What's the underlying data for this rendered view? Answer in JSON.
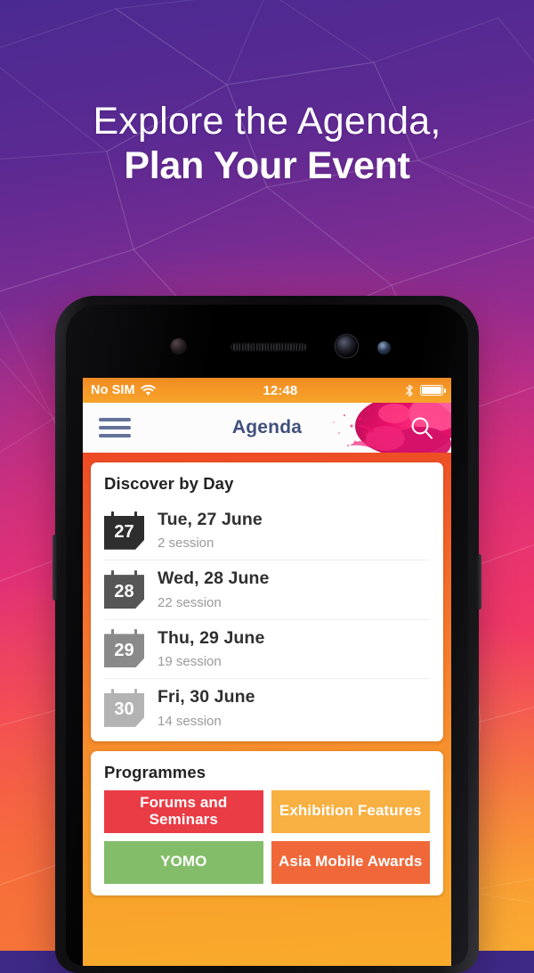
{
  "promo": {
    "headline_line1": "Explore the Agenda,",
    "headline_line2": "Plan Your Event",
    "bg_purple": "#4a2a91",
    "bg_magenta": "#ef3a62",
    "bg_orange": "#f9a12b"
  },
  "status_bar": {
    "carrier": "No SIM",
    "wifi_icon": "wifi-icon",
    "time": "12:48",
    "bluetooth_icon": "bluetooth-icon",
    "battery_icon": "battery-full-icon",
    "background": "#f59a27"
  },
  "nav_bar": {
    "menu_icon": "hamburger-menu-icon",
    "title": "Agenda",
    "search_icon": "search-icon",
    "title_color": "#41507c"
  },
  "discover": {
    "title": "Discover by Day",
    "days": [
      {
        "num": "27",
        "label": "Tue, 27 June",
        "sessions": "2 session",
        "color": "#2e2e2e"
      },
      {
        "num": "28",
        "label": "Wed, 28 June",
        "sessions": "22 session",
        "color": "#565656"
      },
      {
        "num": "29",
        "label": "Thu, 29 June",
        "sessions": "19 session",
        "color": "#8a8a8a"
      },
      {
        "num": "30",
        "label": "Fri, 30 June",
        "sessions": "14 session",
        "color": "#b3b3b3"
      }
    ]
  },
  "programmes": {
    "title": "Programmes",
    "tiles": [
      {
        "label": "Forums and Seminars",
        "color": "#e93c45"
      },
      {
        "label": "Exhibition Features",
        "color": "#f8b042"
      },
      {
        "label": "YOMO",
        "color": "#84bd6a"
      },
      {
        "label": "Asia Mobile Awards",
        "color": "#f0683a"
      }
    ]
  }
}
